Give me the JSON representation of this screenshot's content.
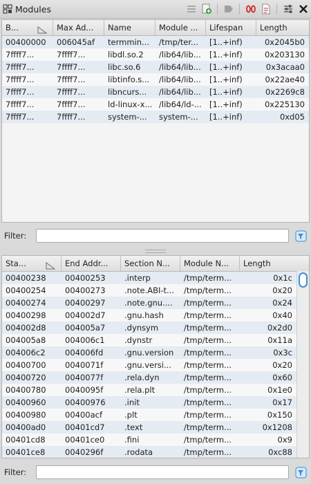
{
  "window": {
    "title": "Modules"
  },
  "toolbar": {
    "buttons": [
      {
        "name": "list-icon",
        "enabled": false
      },
      {
        "name": "add-icon",
        "enabled": true
      },
      {
        "name": "tag-icon",
        "enabled": false
      },
      {
        "name": "binary-icon",
        "enabled": true
      },
      {
        "name": "document-icon",
        "enabled": true
      },
      {
        "name": "settings-icon",
        "enabled": true
      },
      {
        "name": "close-icon",
        "enabled": true
      }
    ]
  },
  "modules": {
    "columns": [
      "B...",
      "Max Ad...",
      "Name",
      "Module ...",
      "Lifespan",
      "Length"
    ],
    "rows": [
      [
        "00400000",
        "006045af",
        "termmin...",
        "/tmp/ter...",
        "[1..+inf)",
        "0x2045b0"
      ],
      [
        "7ffff7...",
        "7ffff7...",
        "libdl.so.2",
        "/lib64/lib...",
        "[1..+inf)",
        "0x203130"
      ],
      [
        "7ffff7...",
        "7ffff7...",
        "libc.so.6",
        "/lib64/lib...",
        "[1..+inf)",
        "0x3acaa0"
      ],
      [
        "7ffff7...",
        "7ffff7...",
        "libtinfo.s...",
        "/lib64/lib...",
        "[1..+inf)",
        "0x22ae40"
      ],
      [
        "7ffff7...",
        "7ffff7...",
        "libncurs...",
        "/lib64/lib...",
        "[1..+inf)",
        "0x2269c8"
      ],
      [
        "7ffff7...",
        "7ffff7...",
        "ld-linux-x...",
        "/lib64/ld-...",
        "[1..+inf)",
        "0x225130"
      ],
      [
        "7ffff7...",
        "7ffff7...",
        "system-...",
        "system-...",
        "[1..+inf)",
        "0xd05"
      ]
    ]
  },
  "filter_top": {
    "label": "Filter:",
    "value": ""
  },
  "sections": {
    "columns": [
      "Sta...",
      "End Addr...",
      "Section N...",
      "Module N...",
      "Length"
    ],
    "rows": [
      [
        "00400238",
        "00400253",
        ".interp",
        "/tmp/term...",
        "0x1c"
      ],
      [
        "00400254",
        "00400273",
        ".note.ABI-t...",
        "/tmp/term...",
        "0x20"
      ],
      [
        "00400274",
        "00400297",
        ".note.gnu....",
        "/tmp/term...",
        "0x24"
      ],
      [
        "00400298",
        "004002d7",
        ".gnu.hash",
        "/tmp/term...",
        "0x40"
      ],
      [
        "004002d8",
        "004005a7",
        ".dynsym",
        "/tmp/term...",
        "0x2d0"
      ],
      [
        "004005a8",
        "004006c1",
        ".dynstr",
        "/tmp/term...",
        "0x11a"
      ],
      [
        "004006c2",
        "004006fd",
        ".gnu.version",
        "/tmp/term...",
        "0x3c"
      ],
      [
        "00400700",
        "0040071f",
        ".gnu.versi...",
        "/tmp/term...",
        "0x20"
      ],
      [
        "00400720",
        "0040077f",
        ".rela.dyn",
        "/tmp/term...",
        "0x60"
      ],
      [
        "00400780",
        "0040095f",
        ".rela.plt",
        "/tmp/term...",
        "0x1e0"
      ],
      [
        "00400960",
        "00400976",
        ".init",
        "/tmp/term...",
        "0x17"
      ],
      [
        "00400980",
        "00400acf",
        ".plt",
        "/tmp/term...",
        "0x150"
      ],
      [
        "00400ad0",
        "00401cd7",
        ".text",
        "/tmp/term...",
        "0x1208"
      ],
      [
        "00401cd8",
        "00401ce0",
        ".fini",
        "/tmp/term...",
        "0x9"
      ],
      [
        "00401ce8",
        "0040296f",
        ".rodata",
        "/tmp/term...",
        "0xc88"
      ]
    ],
    "scroll_position": 0.0
  },
  "filter_bottom": {
    "label": "Filter:",
    "value": ""
  },
  "colors": {
    "row_alt": "#e5ebf2",
    "row_plain": "#f7f7f7",
    "scroll_accent": "#3c8ad6",
    "icon_red": "#cc2a2a",
    "icon_green": "#3a9a3a"
  }
}
